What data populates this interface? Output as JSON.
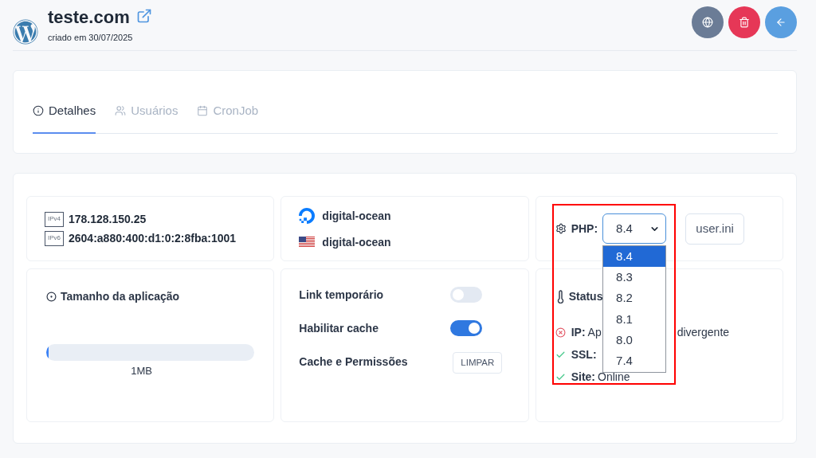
{
  "header": {
    "title": "teste.com",
    "subtitle": "criado em 30/07/2025",
    "actions": [
      {
        "kind": "globe"
      },
      {
        "kind": "delete"
      },
      {
        "kind": "back"
      }
    ]
  },
  "tabs": [
    {
      "label": "Detalhes",
      "selected": true
    },
    {
      "label": "Usuários",
      "selected": false
    },
    {
      "label": "CronJob",
      "selected": false
    }
  ],
  "addresses": [
    {
      "tag": "IPv4",
      "value": "178.128.150.25"
    },
    {
      "tag": "IPv6",
      "value": "2604:a880:400:d1:0:2:8fba:1001"
    }
  ],
  "hosting": [
    {
      "kind": "provider",
      "label": "digital-ocean"
    },
    {
      "kind": "region",
      "label": "digital-ocean"
    }
  ],
  "php": {
    "label": "PHP:",
    "value": "8.4",
    "open": true,
    "highlighted": true,
    "options": [
      {
        "label": "8.4",
        "selected": true
      },
      {
        "label": "8.3",
        "selected": false
      },
      {
        "label": "8.2",
        "selected": false
      },
      {
        "label": "8.1",
        "selected": false
      },
      {
        "label": "8.0",
        "selected": false
      },
      {
        "label": "7.4",
        "selected": false
      }
    ],
    "config_button": "user.ini"
  },
  "app_size": {
    "title": "Tamanho da aplicação",
    "level": 0.01,
    "reading": "1MB"
  },
  "settings": [
    {
      "kind": "toggle",
      "label": "Link temporário",
      "on": false
    },
    {
      "kind": "toggle",
      "label": "Habilitar cache",
      "on": true
    },
    {
      "kind": "button",
      "label": "Cache e Permissões",
      "button": "LIMPAR"
    }
  ],
  "status": {
    "title": "Status",
    "checks": [
      {
        "label": "IP:",
        "ok": false,
        "value_parts": [
          "Ap",
          "divergente"
        ]
      },
      {
        "label": "SSL:",
        "ok": true
      },
      {
        "label": "Site:",
        "ok": true,
        "value_parts": [
          "Online"
        ]
      }
    ]
  }
}
